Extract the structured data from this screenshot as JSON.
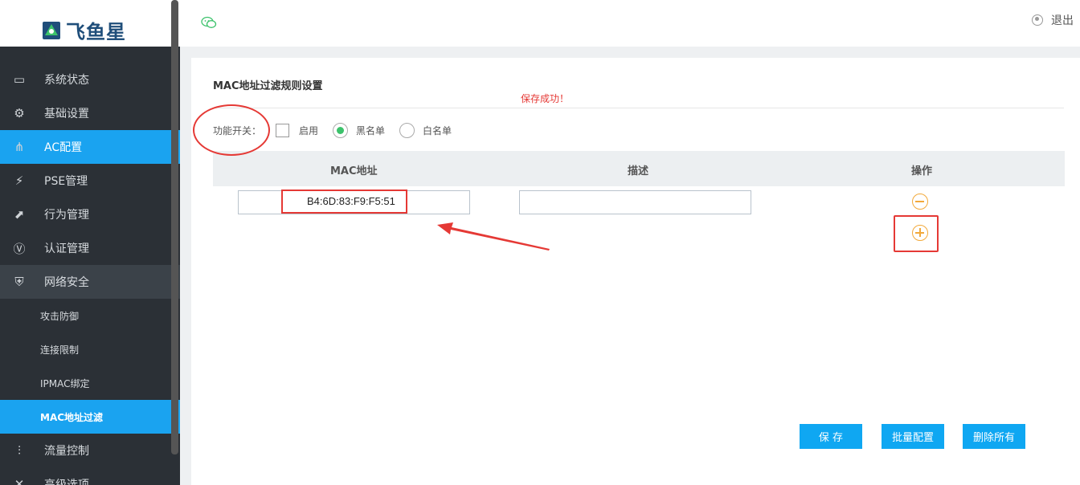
{
  "brand": {
    "name": "飞鱼星"
  },
  "topbar": {
    "logout_label": "退出"
  },
  "sidebar": {
    "items": [
      {
        "label": "系统状态",
        "icon": "monitor-icon",
        "glyph": "▭"
      },
      {
        "label": "基础设置",
        "icon": "gear-icon",
        "glyph": "⚙"
      },
      {
        "label": "AC配置",
        "icon": "network-icon",
        "glyph": "⋔",
        "active": true
      },
      {
        "label": "PSE管理",
        "icon": "lightning-icon",
        "glyph": "⚡"
      },
      {
        "label": "行为管理",
        "icon": "chart-line-icon",
        "glyph": "⬈"
      },
      {
        "label": "认证管理",
        "icon": "verify-icon",
        "glyph": "Ⓥ"
      },
      {
        "label": "网络安全",
        "icon": "shield-icon",
        "glyph": "⛨",
        "open": true
      },
      {
        "label": "流量控制",
        "icon": "sliders-icon",
        "glyph": "⫶"
      },
      {
        "label": "高级选项",
        "icon": "tools-icon",
        "glyph": "✕"
      }
    ],
    "security_sub": [
      {
        "label": "攻击防御"
      },
      {
        "label": "连接限制"
      },
      {
        "label": "IPMAC绑定"
      },
      {
        "label": "MAC地址过滤",
        "active": true
      }
    ]
  },
  "page": {
    "title": "MAC地址过滤规则设置",
    "success_message": "保存成功！",
    "switch": {
      "label": "功能开关：",
      "enable_label": "启用",
      "enable_checked": false,
      "blacklist_label": "黑名单",
      "whitelist_label": "白名单",
      "selected_mode": "黑名单"
    },
    "table": {
      "headers": [
        "MAC地址",
        "描述",
        "操作"
      ],
      "rows": [
        {
          "mac": "B4:6D:83:F9:F5:51",
          "description": ""
        }
      ]
    },
    "buttons": {
      "save": "保 存",
      "batch": "批量配置",
      "delete_all": "删除所有"
    }
  },
  "colors": {
    "accent": "#1aa3f0",
    "sidebar_bg": "#2b3036",
    "button_bg": "#0fa7f2",
    "radio_on": "#3cc26b",
    "op_icon": "#f2a93b",
    "annotation": "#e53935",
    "success_text": "#e53935"
  }
}
